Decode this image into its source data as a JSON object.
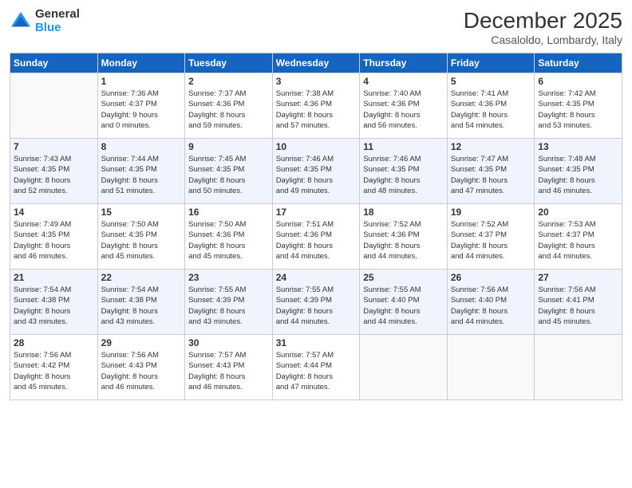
{
  "logo": {
    "general": "General",
    "blue": "Blue"
  },
  "header": {
    "month": "December 2025",
    "location": "Casaloldo, Lombardy, Italy"
  },
  "days_of_week": [
    "Sunday",
    "Monday",
    "Tuesday",
    "Wednesday",
    "Thursday",
    "Friday",
    "Saturday"
  ],
  "weeks": [
    [
      {
        "day": "",
        "info": ""
      },
      {
        "day": "1",
        "info": "Sunrise: 7:36 AM\nSunset: 4:37 PM\nDaylight: 9 hours\nand 0 minutes."
      },
      {
        "day": "2",
        "info": "Sunrise: 7:37 AM\nSunset: 4:36 PM\nDaylight: 8 hours\nand 59 minutes."
      },
      {
        "day": "3",
        "info": "Sunrise: 7:38 AM\nSunset: 4:36 PM\nDaylight: 8 hours\nand 57 minutes."
      },
      {
        "day": "4",
        "info": "Sunrise: 7:40 AM\nSunset: 4:36 PM\nDaylight: 8 hours\nand 56 minutes."
      },
      {
        "day": "5",
        "info": "Sunrise: 7:41 AM\nSunset: 4:36 PM\nDaylight: 8 hours\nand 54 minutes."
      },
      {
        "day": "6",
        "info": "Sunrise: 7:42 AM\nSunset: 4:35 PM\nDaylight: 8 hours\nand 53 minutes."
      }
    ],
    [
      {
        "day": "7",
        "info": "Sunrise: 7:43 AM\nSunset: 4:35 PM\nDaylight: 8 hours\nand 52 minutes."
      },
      {
        "day": "8",
        "info": "Sunrise: 7:44 AM\nSunset: 4:35 PM\nDaylight: 8 hours\nand 51 minutes."
      },
      {
        "day": "9",
        "info": "Sunrise: 7:45 AM\nSunset: 4:35 PM\nDaylight: 8 hours\nand 50 minutes."
      },
      {
        "day": "10",
        "info": "Sunrise: 7:46 AM\nSunset: 4:35 PM\nDaylight: 8 hours\nand 49 minutes."
      },
      {
        "day": "11",
        "info": "Sunrise: 7:46 AM\nSunset: 4:35 PM\nDaylight: 8 hours\nand 48 minutes."
      },
      {
        "day": "12",
        "info": "Sunrise: 7:47 AM\nSunset: 4:35 PM\nDaylight: 8 hours\nand 47 minutes."
      },
      {
        "day": "13",
        "info": "Sunrise: 7:48 AM\nSunset: 4:35 PM\nDaylight: 8 hours\nand 46 minutes."
      }
    ],
    [
      {
        "day": "14",
        "info": "Sunrise: 7:49 AM\nSunset: 4:35 PM\nDaylight: 8 hours\nand 46 minutes."
      },
      {
        "day": "15",
        "info": "Sunrise: 7:50 AM\nSunset: 4:35 PM\nDaylight: 8 hours\nand 45 minutes."
      },
      {
        "day": "16",
        "info": "Sunrise: 7:50 AM\nSunset: 4:36 PM\nDaylight: 8 hours\nand 45 minutes."
      },
      {
        "day": "17",
        "info": "Sunrise: 7:51 AM\nSunset: 4:36 PM\nDaylight: 8 hours\nand 44 minutes."
      },
      {
        "day": "18",
        "info": "Sunrise: 7:52 AM\nSunset: 4:36 PM\nDaylight: 8 hours\nand 44 minutes."
      },
      {
        "day": "19",
        "info": "Sunrise: 7:52 AM\nSunset: 4:37 PM\nDaylight: 8 hours\nand 44 minutes."
      },
      {
        "day": "20",
        "info": "Sunrise: 7:53 AM\nSunset: 4:37 PM\nDaylight: 8 hours\nand 44 minutes."
      }
    ],
    [
      {
        "day": "21",
        "info": "Sunrise: 7:54 AM\nSunset: 4:38 PM\nDaylight: 8 hours\nand 43 minutes."
      },
      {
        "day": "22",
        "info": "Sunrise: 7:54 AM\nSunset: 4:38 PM\nDaylight: 8 hours\nand 43 minutes."
      },
      {
        "day": "23",
        "info": "Sunrise: 7:55 AM\nSunset: 4:39 PM\nDaylight: 8 hours\nand 43 minutes."
      },
      {
        "day": "24",
        "info": "Sunrise: 7:55 AM\nSunset: 4:39 PM\nDaylight: 8 hours\nand 44 minutes."
      },
      {
        "day": "25",
        "info": "Sunrise: 7:55 AM\nSunset: 4:40 PM\nDaylight: 8 hours\nand 44 minutes."
      },
      {
        "day": "26",
        "info": "Sunrise: 7:56 AM\nSunset: 4:40 PM\nDaylight: 8 hours\nand 44 minutes."
      },
      {
        "day": "27",
        "info": "Sunrise: 7:56 AM\nSunset: 4:41 PM\nDaylight: 8 hours\nand 45 minutes."
      }
    ],
    [
      {
        "day": "28",
        "info": "Sunrise: 7:56 AM\nSunset: 4:42 PM\nDaylight: 8 hours\nand 45 minutes."
      },
      {
        "day": "29",
        "info": "Sunrise: 7:56 AM\nSunset: 4:43 PM\nDaylight: 8 hours\nand 46 minutes."
      },
      {
        "day": "30",
        "info": "Sunrise: 7:57 AM\nSunset: 4:43 PM\nDaylight: 8 hours\nand 46 minutes."
      },
      {
        "day": "31",
        "info": "Sunrise: 7:57 AM\nSunset: 4:44 PM\nDaylight: 8 hours\nand 47 minutes."
      },
      {
        "day": "",
        "info": ""
      },
      {
        "day": "",
        "info": ""
      },
      {
        "day": "",
        "info": ""
      }
    ]
  ]
}
